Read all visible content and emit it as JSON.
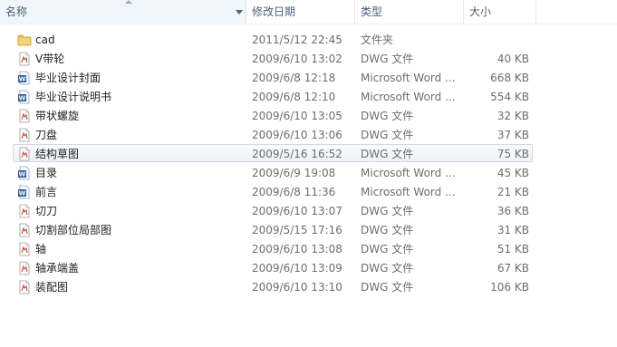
{
  "columns": {
    "name": "名称",
    "date": "修改日期",
    "type": "类型",
    "size": "大小"
  },
  "files": [
    {
      "name": "cad",
      "date": "2011/5/12 22:45",
      "type": "文件夹",
      "size": "",
      "icon": "folder-icon"
    },
    {
      "name": "V带轮",
      "date": "2009/6/10 13:02",
      "type": "DWG 文件",
      "size": "40 KB",
      "icon": "dwg-file-icon"
    },
    {
      "name": "毕业设计封面",
      "date": "2009/6/8 12:18",
      "type": "Microsoft Word ...",
      "size": "668 KB",
      "icon": "word-doc-icon"
    },
    {
      "name": "毕业设计说明书",
      "date": "2009/6/8 12:10",
      "type": "Microsoft Word ...",
      "size": "554 KB",
      "icon": "word-doc-icon"
    },
    {
      "name": "带状螺旋",
      "date": "2009/6/10 13:05",
      "type": "DWG 文件",
      "size": "32 KB",
      "icon": "dwg-file-icon"
    },
    {
      "name": "刀盘",
      "date": "2009/6/10 13:06",
      "type": "DWG 文件",
      "size": "37 KB",
      "icon": "dwg-file-icon"
    },
    {
      "name": "结构草图",
      "date": "2009/5/16 16:52",
      "type": "DWG 文件",
      "size": "75 KB",
      "icon": "dwg-file-icon"
    },
    {
      "name": "目录",
      "date": "2009/6/9 19:08",
      "type": "Microsoft Word ...",
      "size": "45 KB",
      "icon": "word-doc-icon"
    },
    {
      "name": "前言",
      "date": "2009/6/8 11:36",
      "type": "Microsoft Word ...",
      "size": "21 KB",
      "icon": "word-doc-icon"
    },
    {
      "name": "切刀",
      "date": "2009/6/10 13:07",
      "type": "DWG 文件",
      "size": "36 KB",
      "icon": "dwg-file-icon"
    },
    {
      "name": "切割部位局部图",
      "date": "2009/5/15 17:16",
      "type": "DWG 文件",
      "size": "31 KB",
      "icon": "dwg-file-icon"
    },
    {
      "name": "轴",
      "date": "2009/6/10 13:08",
      "type": "DWG 文件",
      "size": "51 KB",
      "icon": "dwg-file-icon"
    },
    {
      "name": "轴承端盖",
      "date": "2009/6/10 13:09",
      "type": "DWG 文件",
      "size": "67 KB",
      "icon": "dwg-file-icon"
    },
    {
      "name": "装配图",
      "date": "2009/6/10 13:10",
      "type": "DWG 文件",
      "size": "106 KB",
      "icon": "dwg-file-icon"
    }
  ],
  "hovered_row": "结构草图",
  "colors": {
    "header_text": "#4c607a",
    "detail_text": "#6d6d6d",
    "folder": "#e8c15a",
    "word_blue": "#2b5797",
    "dwg_red": "#c0392b"
  }
}
